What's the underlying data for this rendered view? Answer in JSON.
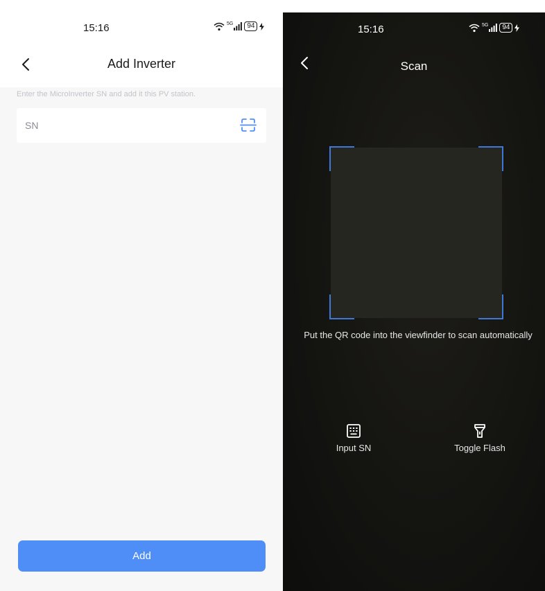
{
  "left_screen": {
    "status_bar": {
      "time": "15:16",
      "network": "5G",
      "battery": "94"
    },
    "nav": {
      "title": "Add Inverter"
    },
    "hint": "Enter the MicroInverter SN  and add it this PV station.",
    "sn_field": {
      "placeholder": "SN",
      "value": ""
    },
    "add_button": "Add",
    "colors": {
      "accent": "#4f8ef7",
      "background": "#f7f7f8"
    }
  },
  "right_screen": {
    "status_bar": {
      "time": "15:16",
      "network": "5G",
      "battery": "94"
    },
    "nav": {
      "title": "Scan"
    },
    "scan_hint": "Put the QR code into the viewfinder to scan automatically",
    "actions": [
      {
        "label": "Input SN",
        "icon": "keyboard-icon"
      },
      {
        "label": "Toggle Flash",
        "icon": "flashlight-icon"
      }
    ],
    "colors": {
      "viewfinder_corner": "#3f78d8",
      "background": "#141411"
    }
  }
}
